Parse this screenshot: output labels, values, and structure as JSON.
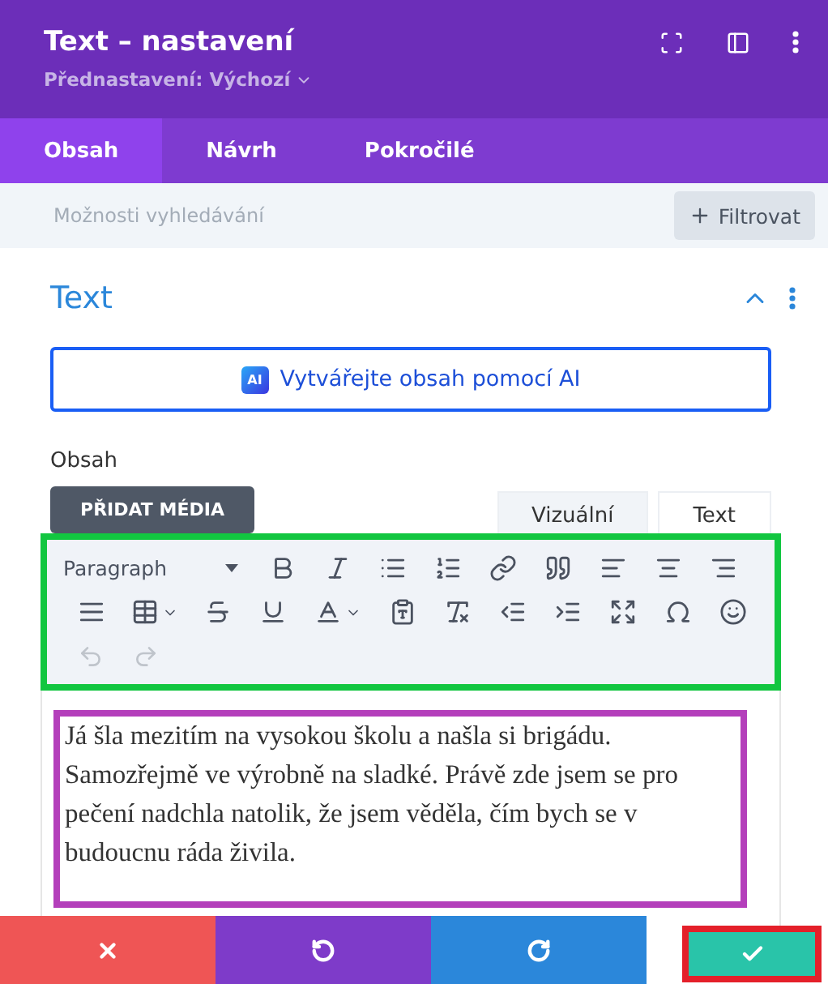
{
  "header": {
    "title": "Text – nastavení",
    "preset": "Přednastavení: Výchozí"
  },
  "tabs": [
    {
      "label": "Obsah",
      "selected": true
    },
    {
      "label": "Návrh",
      "selected": false
    },
    {
      "label": "Pokročilé",
      "selected": false
    }
  ],
  "search": {
    "placeholder": "Možnosti vyhledávání",
    "filter_button": "Filtrovat"
  },
  "section": {
    "title": "Text",
    "expanded": true,
    "ai_button": "Vytvářejte obsah pomocí AI",
    "ai_badge": "AI",
    "content_label": "Obsah",
    "add_media": "PŘIDAT MÉDIA",
    "editor_tabs": [
      {
        "label": "Vizuální",
        "selected": true
      },
      {
        "label": "Text",
        "selected": false
      }
    ],
    "format_select": "Paragraph",
    "history": [
      {
        "kind": "undo",
        "disabled": true
      },
      {
        "kind": "redo",
        "disabled": true
      }
    ],
    "paragraph": "Já šla mezitím na vysokou školu a našla si brigádu. Samozřejmě ve výrobně na sladké. Právě zde jsem se pro pečení nadchla natolik, že jsem věděla, čím bych se v budoucnu ráda živila."
  },
  "footer": [
    {
      "kind": "cancel"
    },
    {
      "kind": "undo"
    },
    {
      "kind": "redo"
    },
    {
      "kind": "save"
    }
  ]
}
